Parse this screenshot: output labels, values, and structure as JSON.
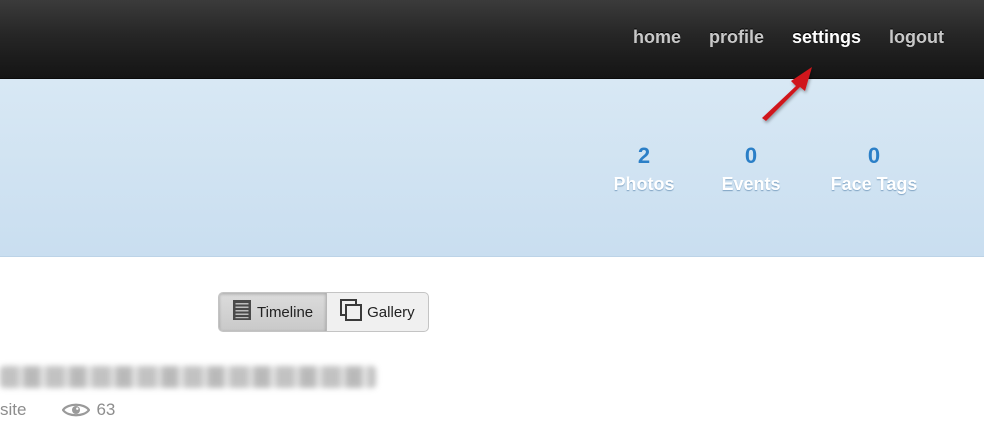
{
  "header": {
    "nav": [
      {
        "label": "home",
        "active": false
      },
      {
        "label": "profile",
        "active": false
      },
      {
        "label": "settings",
        "active": true
      },
      {
        "label": "logout",
        "active": false
      }
    ]
  },
  "banner": {
    "stats": [
      {
        "value": "2",
        "label": "Photos"
      },
      {
        "value": "0",
        "label": "Events"
      },
      {
        "value": "0",
        "label": "Face Tags"
      }
    ]
  },
  "view_toggle": {
    "timeline_label": "Timeline",
    "gallery_label": "Gallery",
    "selected": "Timeline"
  },
  "post": {
    "source_fragment": "site",
    "views": "63"
  },
  "colors": {
    "accent": "#2b7fc7",
    "annotation_arrow": "#d0161b"
  },
  "icons": [
    "timeline-icon",
    "gallery-icon",
    "eye-icon",
    "annotation-arrow"
  ]
}
